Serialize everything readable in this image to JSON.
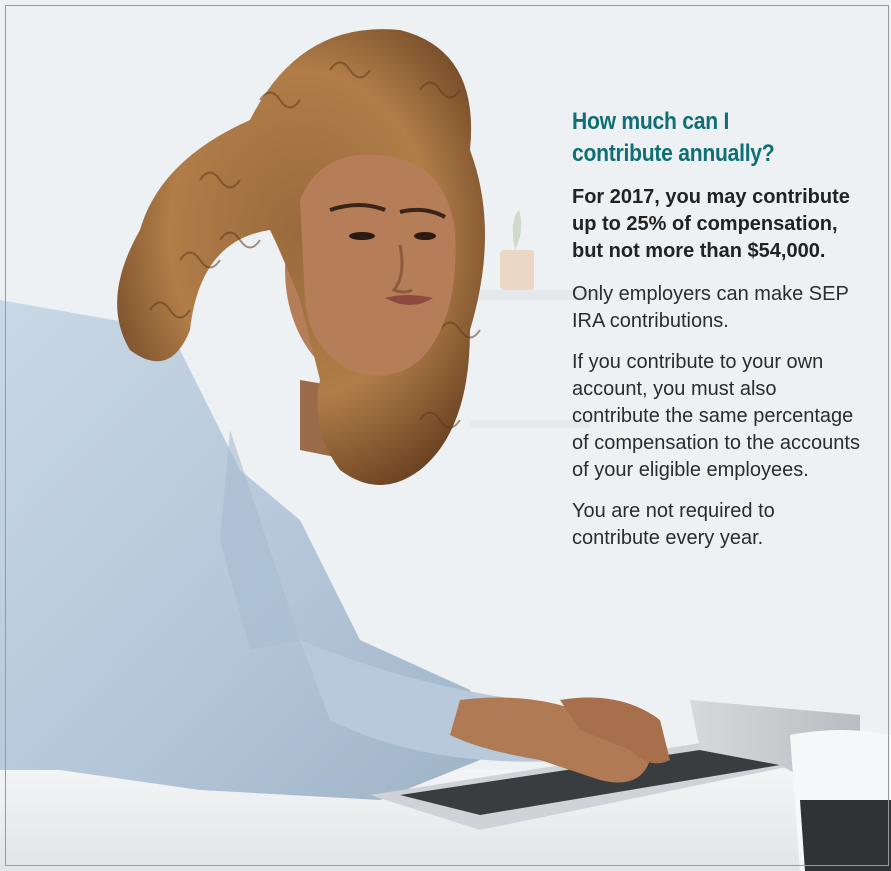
{
  "heading": "How much can I contribute annually?",
  "lead": "For 2017, you may contribute up to 25% of compensation, but not more than $54,000.",
  "paragraphs": [
    "Only employers can make SEP IRA contributions.",
    "If you contribute to your own account, you must also contribute the same percentage of compensation to the accounts of your eligible employees.",
    "You are not required to contribute every year."
  ],
  "colors": {
    "heading": "#0f6f75",
    "body_text": "#2c2c2c",
    "background": "#eef1f3"
  }
}
